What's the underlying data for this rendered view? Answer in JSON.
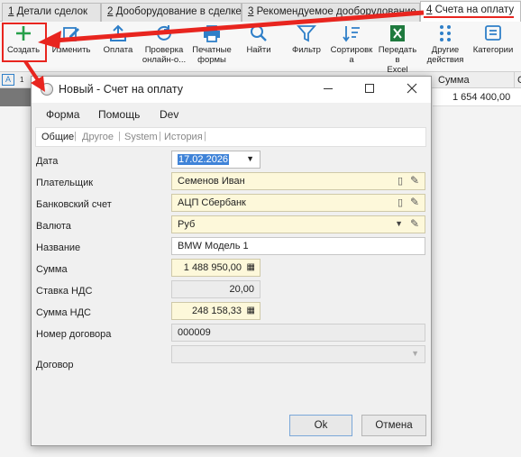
{
  "tabs": [
    {
      "num": "1",
      "label": " Детали сделок"
    },
    {
      "num": "2",
      "label": " Дооборудование в сделке"
    },
    {
      "num": "3",
      "label": " Рекомендуемое дооборудование"
    },
    {
      "num": "4",
      "label": " Счета на оплату"
    }
  ],
  "toolbar": {
    "create": "Создать",
    "edit": "Изменить",
    "payment": "Оплата",
    "check_line1": "Проверка",
    "check_line2": "онлайн-о...",
    "print_line1": "Печатные",
    "print_line2": "формы",
    "find": "Найти",
    "filter": "Фильтр",
    "sort_line1": "Сортировк",
    "sort_line2": "а",
    "excel_line1": "Передать в",
    "excel_line2": "Excel",
    "other_line1": "Другие",
    "other_line2": "действия",
    "categories": "Категории"
  },
  "grid": {
    "col_sum": "Сумма",
    "col_c": "С",
    "row_sum": "1 654 400,00",
    "left_a": "1",
    "left_b": "1"
  },
  "dialog": {
    "title": "Новый - Счет на оплату",
    "menu": {
      "form": "Форма",
      "help": "Помощь",
      "dev": "Dev"
    },
    "subtabs": {
      "general": "Общие",
      "other": "Другое",
      "system": "System",
      "history": "История"
    },
    "labels": {
      "date": "Дата",
      "payer": "Плательщик",
      "bank": "Банковский счет",
      "currency": "Валюта",
      "name": "Название",
      "sum": "Сумма",
      "vat_rate": "Ставка НДС",
      "vat_sum": "Сумма НДС",
      "contract_num": "Номер договора",
      "contract": "Договор"
    },
    "values": {
      "date": "17.02.2026",
      "payer": "Семенов Иван",
      "bank": "АЦП Сбербанк",
      "currency": "Руб",
      "name": "BMW Модель 1",
      "sum": "1 488 950,00",
      "vat_rate": "20,00",
      "vat_sum": "248 158,33",
      "contract_num": "000009",
      "contract": ""
    },
    "ok": "Ok",
    "cancel": "Отмена"
  },
  "colors": {
    "accent_red": "#e8251f",
    "green": "#27a04a",
    "blue": "#2f7fc8",
    "selection": "#3f83d8"
  }
}
